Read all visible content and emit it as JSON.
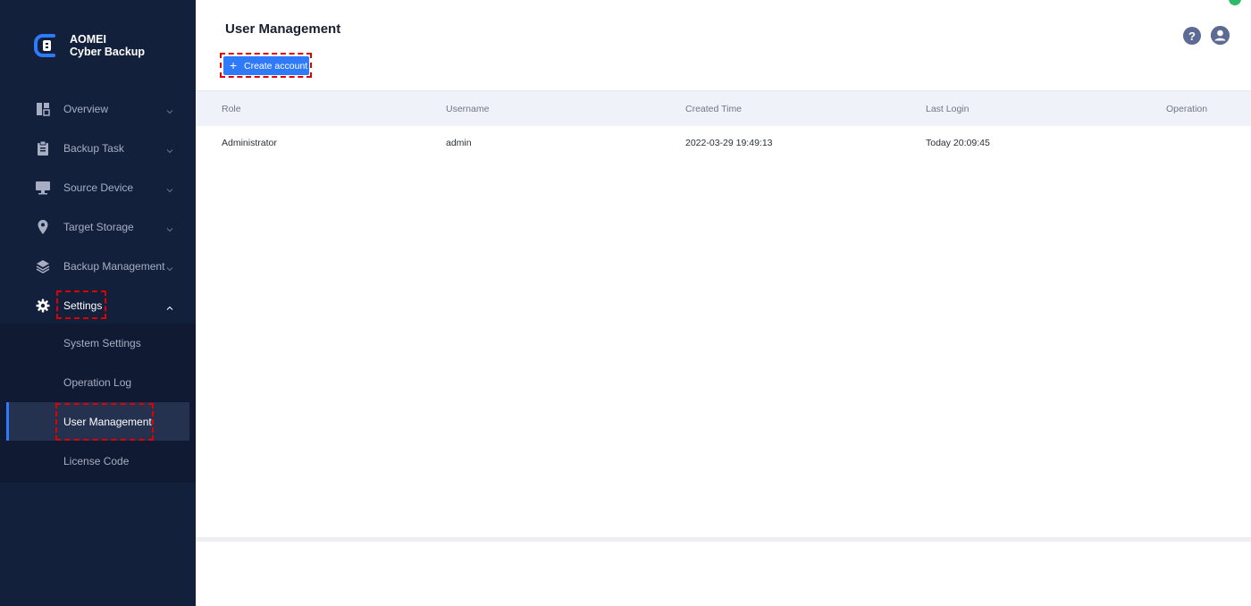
{
  "app": {
    "brand_line1": "AOMEI",
    "brand_line2": "Cyber Backup",
    "accent": "#2f7af8",
    "sidebar_bg": "#13203c"
  },
  "sidebar": {
    "items": [
      {
        "label": "Overview",
        "icon": "overview-icon"
      },
      {
        "label": "Backup Task",
        "icon": "clipboard-icon"
      },
      {
        "label": "Source Device",
        "icon": "monitor-icon"
      },
      {
        "label": "Target Storage",
        "icon": "location-pin-icon"
      },
      {
        "label": "Backup Management",
        "icon": "layers-icon"
      },
      {
        "label": "Settings",
        "icon": "gear-icon"
      }
    ],
    "sub_items": [
      {
        "label": "System Settings"
      },
      {
        "label": "Operation Log"
      },
      {
        "label": "User Management"
      },
      {
        "label": "License Code"
      }
    ]
  },
  "main": {
    "title": "User Management",
    "create_button": "Create account",
    "help_icon": "question-icon",
    "user_icon": "user-icon",
    "table": {
      "headers": [
        "Role",
        "Username",
        "Created Time",
        "Last Login",
        "Operation"
      ],
      "rows": [
        [
          "Administrator",
          "admin",
          "2022-03-29 19:49:13",
          "Today 20:09:45",
          ""
        ]
      ]
    }
  }
}
